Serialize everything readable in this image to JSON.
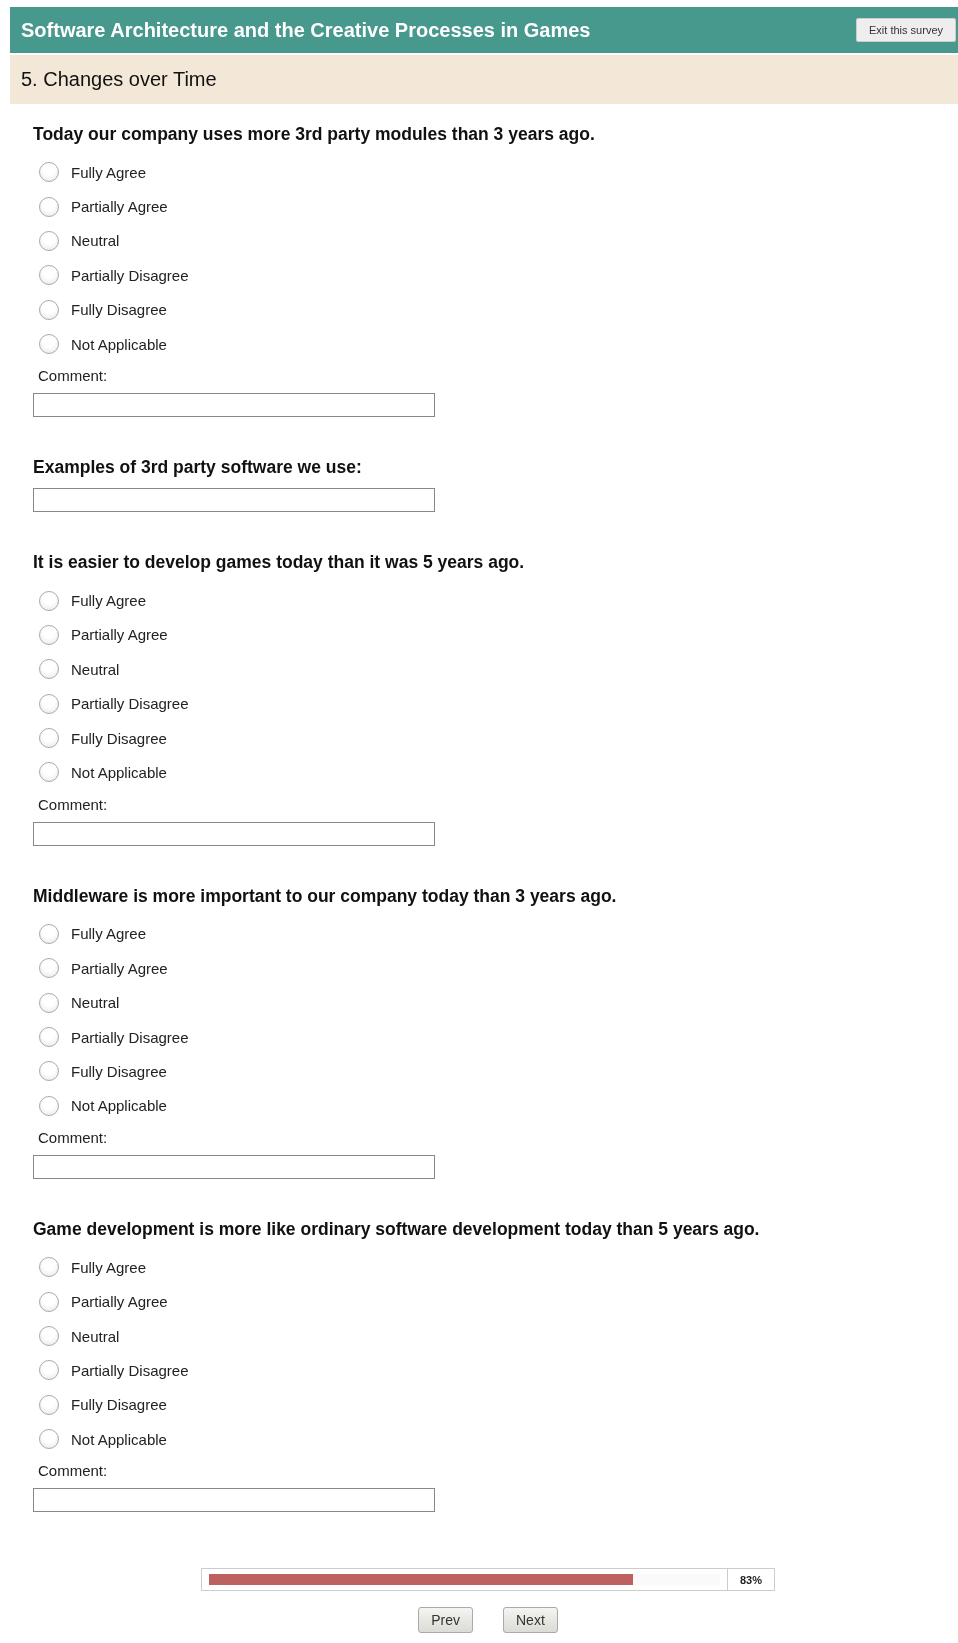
{
  "header": {
    "title": "Software Architecture and the Creative Processes in Games",
    "exit_button": "Exit this survey"
  },
  "section": {
    "title": "5. Changes over Time"
  },
  "questions": [
    {
      "kind": "radio",
      "title": "Today our company uses more 3rd party modules than 3 years ago.",
      "options": [
        {
          "label": "Fully Agree",
          "selected": false
        },
        {
          "label": "Partially Agree",
          "selected": false
        },
        {
          "label": "Neutral",
          "selected": false
        },
        {
          "label": "Partially Disagree",
          "selected": false
        },
        {
          "label": "Fully Disagree",
          "selected": false
        },
        {
          "label": "Not Applicable",
          "selected": false
        }
      ],
      "comment_label": "Comment:"
    },
    {
      "kind": "text",
      "title": "Examples of 3rd party software we use:"
    },
    {
      "kind": "radio",
      "title": "It is easier to develop games today than it was 5 years ago.",
      "options": [
        {
          "label": "Fully Agree",
          "selected": false
        },
        {
          "label": "Partially Agree",
          "selected": false
        },
        {
          "label": "Neutral",
          "selected": false
        },
        {
          "label": "Partially Disagree",
          "selected": false
        },
        {
          "label": "Fully Disagree",
          "selected": false
        },
        {
          "label": "Not Applicable",
          "selected": false
        }
      ],
      "comment_label": "Comment:"
    },
    {
      "kind": "radio",
      "title": "Middleware is more important to our company today than 3 years ago.",
      "options": [
        {
          "label": "Fully Agree",
          "selected": false
        },
        {
          "label": "Partially Agree",
          "selected": false
        },
        {
          "label": "Neutral",
          "selected": false
        },
        {
          "label": "Partially Disagree",
          "selected": false
        },
        {
          "label": "Fully Disagree",
          "selected": false
        },
        {
          "label": "Not Applicable",
          "selected": false
        }
      ],
      "comment_label": "Comment:"
    },
    {
      "kind": "radio",
      "title": "Game development is more like ordinary software development today than 5 years ago.",
      "options": [
        {
          "label": "Fully Agree",
          "selected": false
        },
        {
          "label": "Partially Agree",
          "selected": false
        },
        {
          "label": "Neutral",
          "selected": false
        },
        {
          "label": "Partially Disagree",
          "selected": false
        },
        {
          "label": "Fully Disagree",
          "selected": false
        },
        {
          "label": "Not Applicable",
          "selected": false
        }
      ],
      "comment_label": "Comment:"
    }
  ],
  "progress": {
    "level": 0.83,
    "reading": "83%"
  },
  "buttons": [
    "Prev",
    "Next"
  ]
}
